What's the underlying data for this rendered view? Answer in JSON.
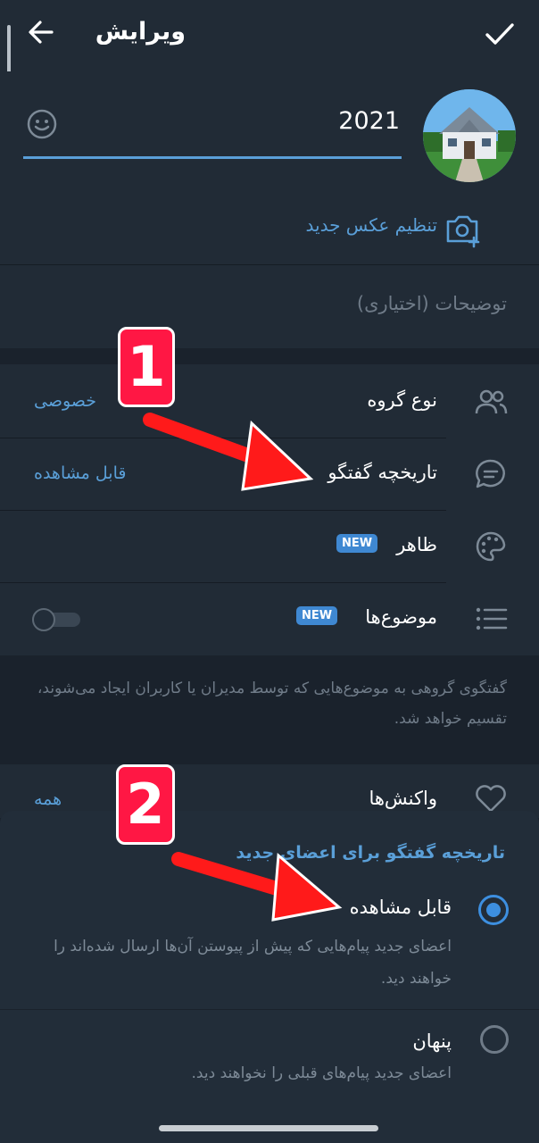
{
  "header": {
    "title": "ویرایش"
  },
  "profile": {
    "name_value": "2021",
    "set_photo_label": "تنظیم عکس جدید",
    "description_placeholder": "توضیحات (اختیاری)"
  },
  "settings": {
    "group_type": {
      "label": "نوع گروه",
      "value": "خصوصی"
    },
    "chat_history": {
      "label": "تاریخچه گفتگو",
      "value": "قابل مشاهده"
    },
    "appearance": {
      "label": "ظاهر",
      "badge": "NEW"
    },
    "topics": {
      "label": "موضوع‌ها",
      "badge": "NEW",
      "enabled": false
    }
  },
  "info": {
    "text": "گفتگوی گروهی به موضوع‌هایی که توسط مدیران یا کاربران ایجاد می‌شوند، تقسیم خواهد شد."
  },
  "reactions": {
    "label": "واکنش‌ها",
    "value": "همه"
  },
  "sheet": {
    "title": "تاریخچه گفتگو برای اعضای جدید",
    "options": [
      {
        "title": "قابل مشاهده",
        "desc": "اعضای جدید پیام‌هایی که پیش از پیوستن آن‌ها ارسال شده‌اند را خواهند دید.",
        "selected": true
      },
      {
        "title": "پنهان",
        "desc": "اعضای جدید پیام‌های قبلی را نخواهند دید.",
        "selected": false
      }
    ]
  },
  "annotations": {
    "marker_1": "1",
    "marker_2": "2"
  },
  "colors": {
    "accent": "#5a9fd8",
    "arrow": "#ff1a1a",
    "marker": "#ff1744",
    "background": "#1a222c"
  }
}
